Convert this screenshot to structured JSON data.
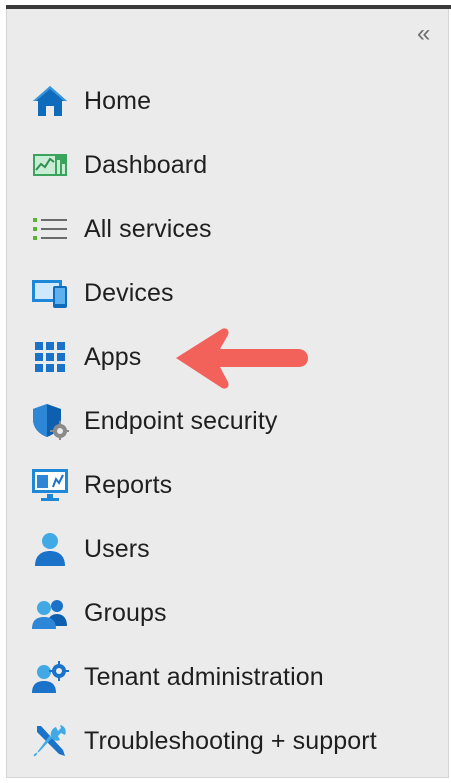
{
  "nav": {
    "collapse_glyph": "«",
    "items": [
      {
        "label": "Home",
        "icon": "home-icon"
      },
      {
        "label": "Dashboard",
        "icon": "dashboard-icon"
      },
      {
        "label": "All services",
        "icon": "list-icon"
      },
      {
        "label": "Devices",
        "icon": "devices-icon"
      },
      {
        "label": "Apps",
        "icon": "apps-grid-icon"
      },
      {
        "label": "Endpoint security",
        "icon": "shield-gear-icon"
      },
      {
        "label": "Reports",
        "icon": "reports-monitor-icon"
      },
      {
        "label": "Users",
        "icon": "user-icon"
      },
      {
        "label": "Groups",
        "icon": "group-icon"
      },
      {
        "label": "Tenant administration",
        "icon": "tenant-admin-icon"
      },
      {
        "label": "Troubleshooting + support",
        "icon": "wrench-screwdriver-icon"
      }
    ]
  },
  "annotation": {
    "arrow_color": "#f2615a",
    "points_to": "Apps"
  },
  "colors": {
    "panel_bg": "#ebebeb",
    "icon_blue": "#0f6cbd",
    "icon_light_blue": "#40a9e6",
    "arrow": "#f2615a"
  }
}
